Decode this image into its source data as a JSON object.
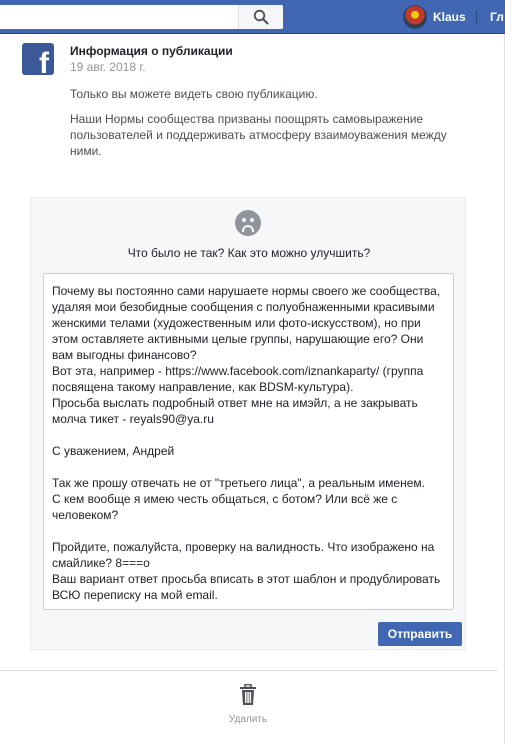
{
  "topbar": {
    "profile_name": "Klaus",
    "home_link": "Гл"
  },
  "post_info": {
    "title": "Информация о публикации",
    "date": "19 авг. 2018 г.",
    "paragraph1": "Только вы можете видеть свою публикацию.",
    "paragraph2_lines": [
      "Наши Нормы сообщества призваны поощрять самовыражение",
      "пользователей и поддерживать атмосферу взаимоуважения между",
      "ними."
    ]
  },
  "feedback": {
    "question": "Что было не так? Как это можно улучшить?",
    "message_lines": [
      "Почему вы постоянно сами нарушаете нормы своего же сообщества,",
      "удаляя мои безобидные сообщения с полуобнаженными красивыми",
      "женскими телами (художественным или фото-искусством), но при",
      "этом оставляете активными целые группы, нарушающие его? Они",
      "вам выгодны финансово?",
      "Вот эта, например - https://www.facebook.com/iznankaparty/ (группа",
      "посвящена такому направление, как BDSM-культура).",
      "Просьба выслать подробный ответ мне на имэйл, а не закрывать",
      "молча тикет - reyals90@ya.ru",
      "",
      "С уважением, Андрей",
      "",
      "Так же прошу отвечать не от \"третьего лица\", а реальным именем.",
      "С кем вообще я имею честь общаться, с ботом? Или всё же с",
      "человеком?",
      "",
      "Пройдите, пожалуйста, проверку на валидность. Что изображено на",
      "смайлике? 8===o",
      "Ваш вариант ответ просьба вписать в этот шаблон и продублировать",
      "ВСЮ переписку на мой email."
    ],
    "send_label": "Отправить"
  },
  "actions": {
    "delete_label": "Удалить"
  },
  "icons": {
    "search": "search-icon",
    "facebook": "facebook-logo-icon",
    "sad_face": "sad-face-icon",
    "trash": "trash-icon"
  },
  "colors": {
    "brand_blue": "#4267b2",
    "facebook_blue": "#3b5998",
    "muted_text": "#90949c"
  }
}
